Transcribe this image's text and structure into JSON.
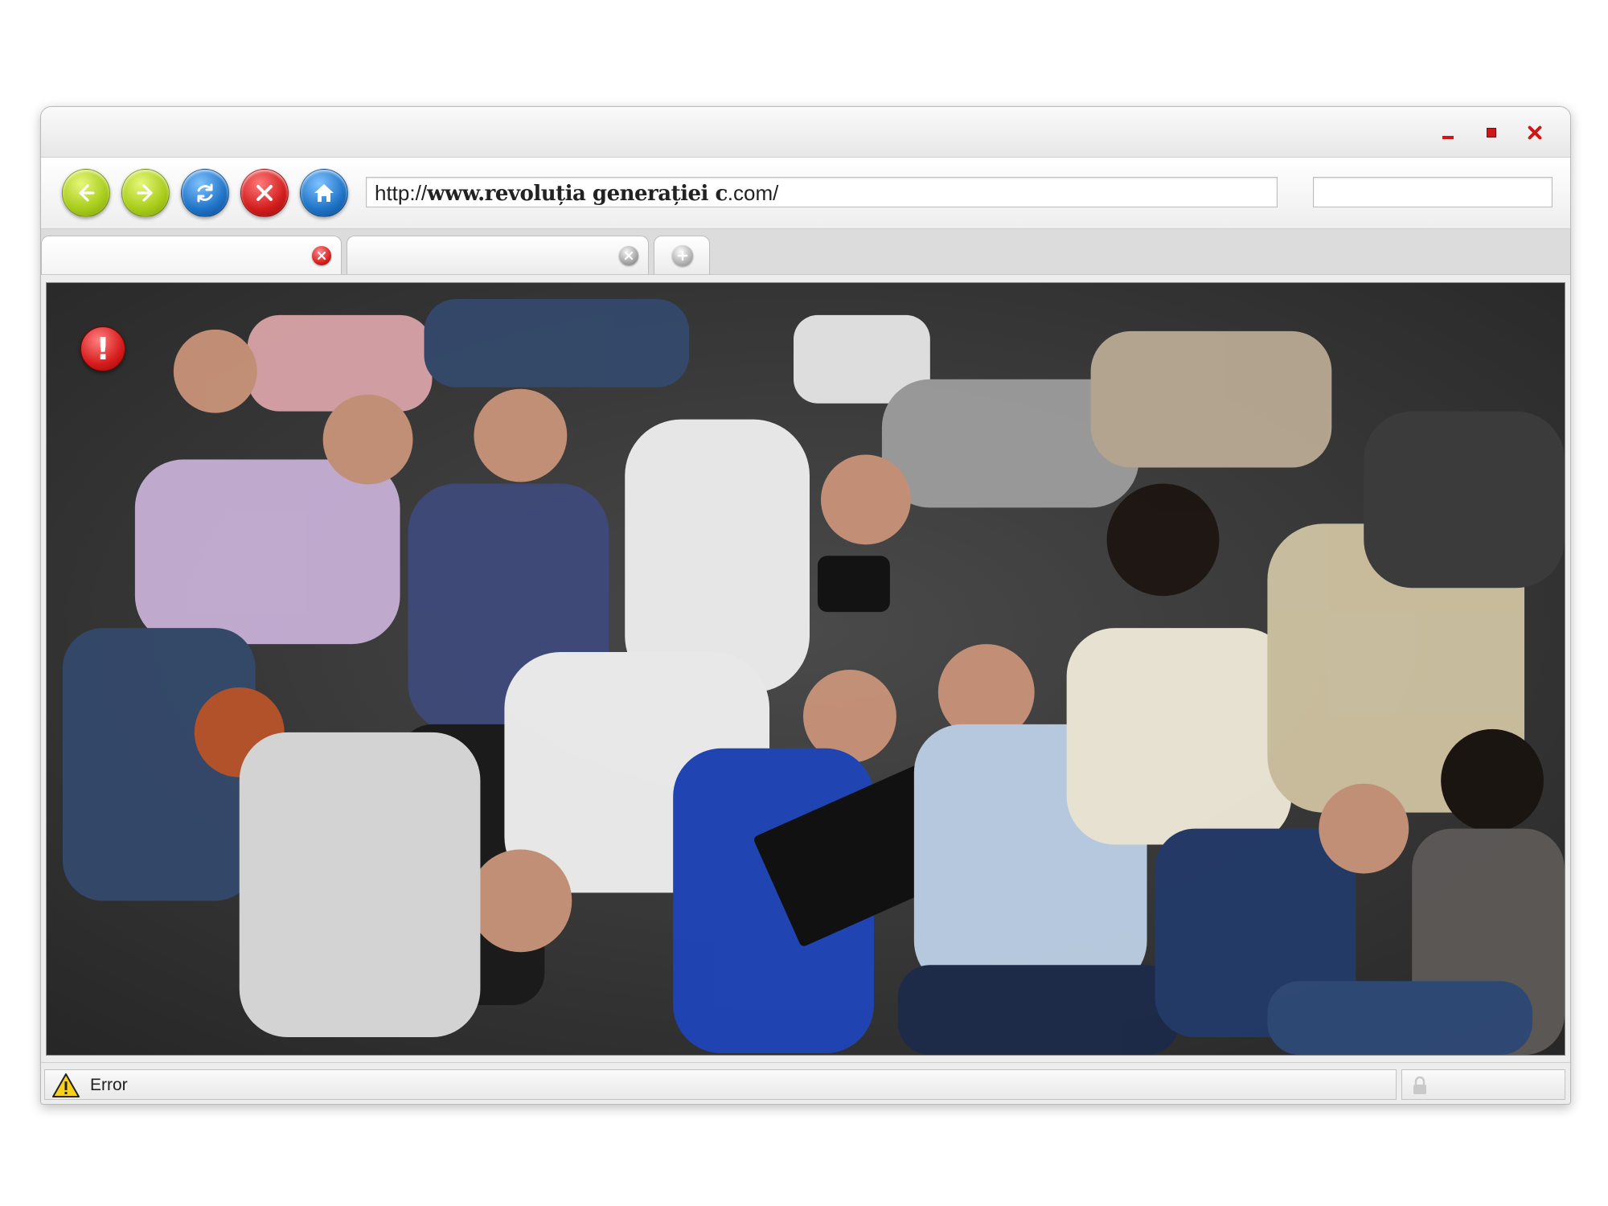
{
  "browser": {
    "address": {
      "scheme": "http://",
      "domain": "www.revoluția generației c",
      "suffix": ".com/"
    },
    "search_placeholder": "",
    "tabs": [
      {
        "label": "",
        "active": true
      },
      {
        "label": "",
        "active": false
      }
    ],
    "colors": {
      "nav_green": "#a7cc1a",
      "nav_blue": "#1f73c6",
      "nav_red": "#d21d1d",
      "window_control": "#d01717"
    },
    "icons": [
      "back-arrow-icon",
      "forward-arrow-icon",
      "refresh-icon",
      "stop-icon",
      "home-icon",
      "alert-icon",
      "warning-icon",
      "lock-icon"
    ]
  },
  "content": {
    "alert_glyph": "!"
  },
  "status": {
    "text": "Error"
  }
}
